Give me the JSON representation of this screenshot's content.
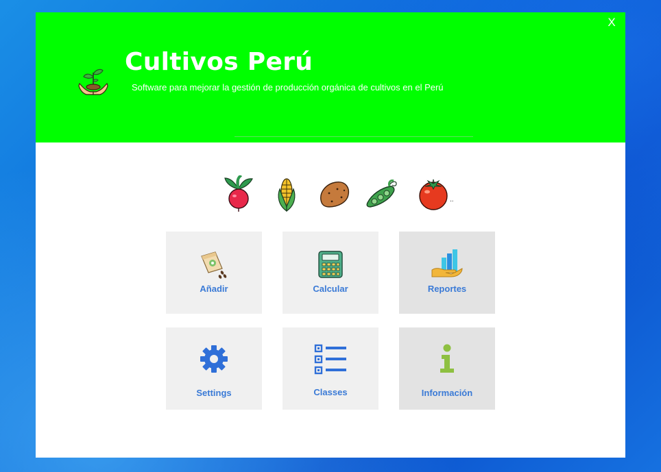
{
  "window": {
    "close_label": "X"
  },
  "header": {
    "title": "Cultivos Perú",
    "subtitle": "Software para mejorar la gestión de producción orgánica de cultivos en el Perú",
    "background_color": "#00ff00"
  },
  "vegetables": {
    "icons": [
      "beet-icon",
      "corn-icon",
      "potato-icon",
      "pea-pod-icon",
      "tomato-icon"
    ],
    "trailing_text": ".."
  },
  "tiles": [
    {
      "label": "Añadir",
      "icon": "seed-packet-icon"
    },
    {
      "label": "Calcular",
      "icon": "calculator-icon"
    },
    {
      "label": "Reportes",
      "icon": "bar-chart-hand-icon"
    },
    {
      "label": "Settings",
      "icon": "gear-icon"
    },
    {
      "label": "Classes",
      "icon": "checklist-icon"
    },
    {
      "label": "Información",
      "icon": "info-icon"
    }
  ],
  "colors": {
    "tile_label": "#3a7ad6",
    "tile_background": "#f0f0f0",
    "tile_background_dark": "#e3e3e3"
  }
}
